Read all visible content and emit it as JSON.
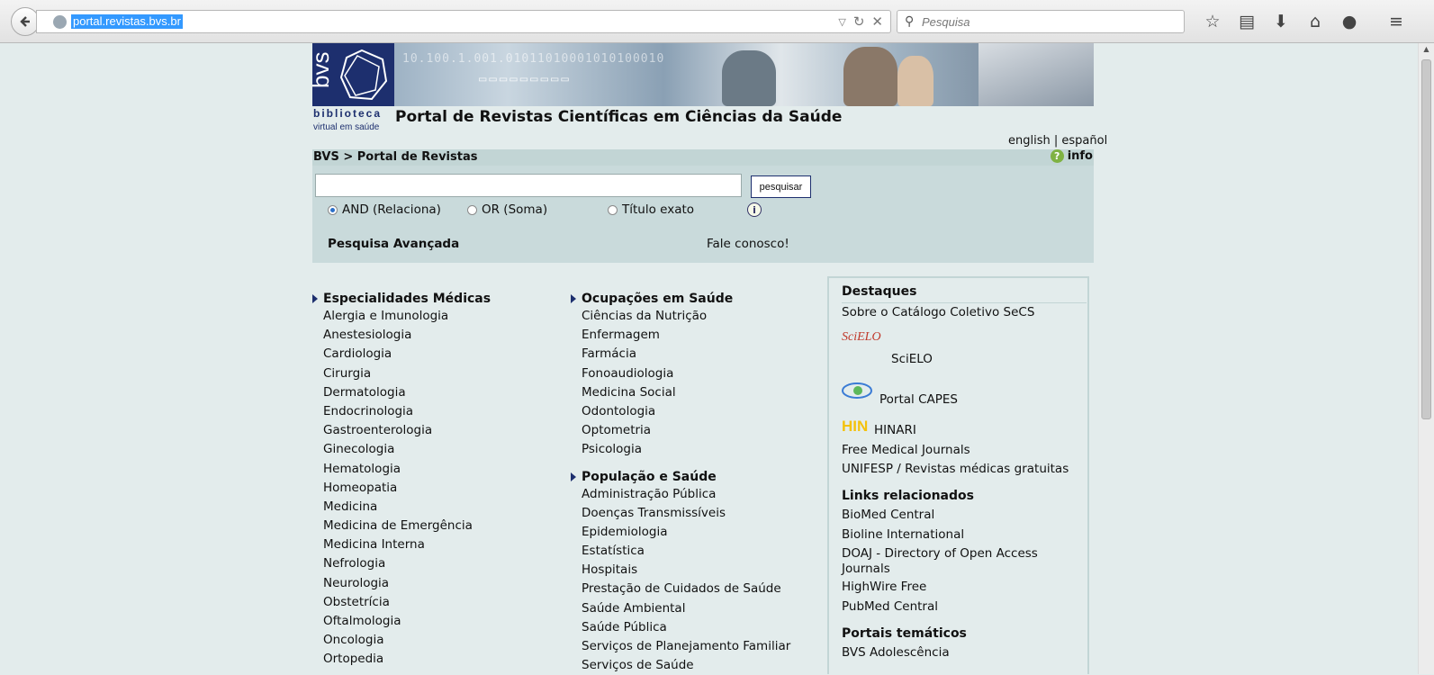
{
  "browser": {
    "url": "portal.revistas.bvs.br",
    "search_placeholder": "Pesquisa",
    "icons": [
      "star-icon",
      "reading-list-icon",
      "download-icon",
      "home-icon",
      "chat-icon",
      "menu-icon"
    ]
  },
  "header": {
    "logo_text": "bvs",
    "biblioteca": "biblioteca",
    "virtual": "virtual em saúde",
    "title": "Portal de Revistas Científicas em Ciências da Saúde",
    "lang_english": "english",
    "lang_sep": " | ",
    "lang_espanol": "español",
    "breadcrumb": "BVS > Portal de Revistas",
    "info": "info"
  },
  "search": {
    "button": "pesquisar",
    "opt_and": "AND (Relaciona)",
    "opt_or": "OR (Soma)",
    "opt_title": "Título exato",
    "advanced": "Pesquisa Avançada",
    "contact": "Fale conosco!"
  },
  "col1": {
    "title": "Especialidades Médicas",
    "items": [
      "Alergia e Imunologia",
      "Anestesiologia",
      "Cardiologia",
      "Cirurgia",
      "Dermatologia",
      "Endocrinologia",
      "Gastroenterologia",
      "Ginecologia",
      "Hematologia",
      "Homeopatia",
      "Medicina",
      "Medicina de Emergência",
      "Medicina Interna",
      "Nefrologia",
      "Neurologia",
      "Obstetrícia",
      "Oftalmologia",
      "Oncologia",
      "Ortopedia"
    ]
  },
  "col2": {
    "title": "Ocupações em Saúde",
    "items": [
      "Ciências da Nutrição",
      "Enfermagem",
      "Farmácia",
      "Fonoaudiologia",
      "Medicina Social",
      "Odontologia",
      "Optometria",
      "Psicologia"
    ],
    "title2": "População e Saúde",
    "items2": [
      "Administração Pública",
      "Doenças Transmissíveis",
      "Epidemiologia",
      "Estatística",
      "Hospitais",
      "Prestação de Cuidados de Saúde",
      "Saúde Ambiental",
      "Saúde Pública",
      "Serviços de Planejamento Familiar",
      "Serviços de Saúde"
    ]
  },
  "destaques": {
    "title": "Destaques",
    "catalogo": "Sobre o Catálogo Coletivo SeCS",
    "scielo": "SciELO",
    "scielo_logo": "SciELO",
    "capes": "Portal CAPES",
    "hin_logo": "HIN",
    "hinari": "HINARI",
    "free": "Free Medical Journals",
    "unifesp": "UNIFESP / Revistas médicas gratuitas",
    "links_title": "Links relacionados",
    "links": [
      "BioMed Central",
      "Bioline International",
      "DOAJ - Directory of Open Access",
      "Journals",
      "HighWire Free",
      "PubMed Central"
    ],
    "portais_title": "Portais temáticos",
    "portais": [
      "BVS Adolescência"
    ]
  }
}
